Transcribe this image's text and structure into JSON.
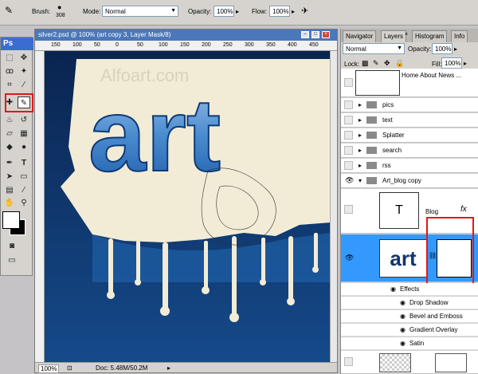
{
  "options_bar": {
    "brush_label": "Brush:",
    "brush_size": "308",
    "mode_label": "Mode:",
    "mode_value": "Normal",
    "opacity_label": "Opacity:",
    "opacity_value": "100%",
    "flow_label": "Flow:",
    "flow_value": "100%"
  },
  "toolbox": {
    "logo": "Ps"
  },
  "document": {
    "title": "silver2.psd @ 100% (art copy 3, Layer Mask/8)",
    "ruler_ticks": [
      "150",
      "100",
      "50",
      "0",
      "50",
      "100",
      "150",
      "200",
      "250",
      "300",
      "350",
      "400",
      "450"
    ],
    "canvas_text_logo": "Alfoart.com",
    "canvas_text_art": "art",
    "zoom": "100%",
    "doc_size": "Doc: 5.48M/50.2M"
  },
  "panels": {
    "tabs": [
      "Navigator",
      "Layers",
      "Histogram",
      "Info"
    ],
    "active_tab": "Layers",
    "blend_mode": "Normal",
    "opacity_label": "Opacity:",
    "opacity_value": "100%",
    "lock_label": "Lock:",
    "fill_label": "Fill:",
    "fill_value": "100%"
  },
  "layers": {
    "top_thumb_text": "Home  About  News ...",
    "groups": [
      "pics",
      "text",
      "Splatter",
      "search",
      "rss"
    ],
    "open_group": "Art_blog copy",
    "blog_layer": {
      "thumb": "T",
      "name": "Blog",
      "fx": "fx"
    },
    "art_layer": {
      "thumb_text": "art"
    },
    "effects_label": "Effects",
    "effects": [
      "Drop Shadow",
      "Bevel and Emboss",
      "Gradient Overlay",
      "Satin"
    ]
  },
  "colors": {
    "selection": "#3399ff",
    "highlight": "#e01818",
    "titlebar": "#4a78b8"
  }
}
